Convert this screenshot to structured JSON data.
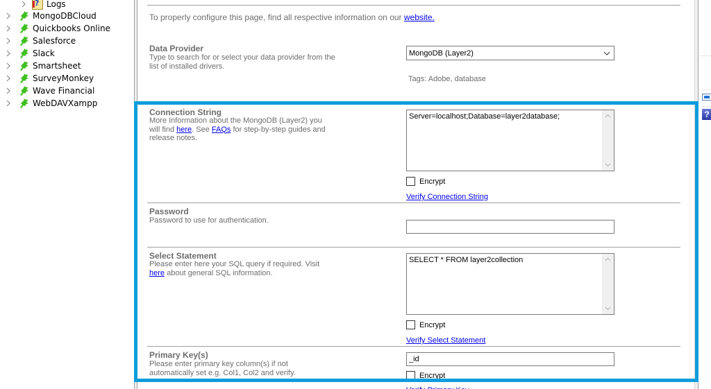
{
  "tree": {
    "items": [
      {
        "label": "Logs",
        "icon": "logs-icon"
      },
      {
        "label": "MongoDBCloud",
        "icon": "plugin-icon"
      },
      {
        "label": "Quickbooks Online",
        "icon": "plugin-icon"
      },
      {
        "label": "Salesforce",
        "icon": "plugin-icon"
      },
      {
        "label": "Slack",
        "icon": "plugin-icon"
      },
      {
        "label": "Smartsheet",
        "icon": "plugin-icon"
      },
      {
        "label": "SurveyMonkey",
        "icon": "plugin-icon"
      },
      {
        "label": "Wave Financial",
        "icon": "plugin-icon"
      },
      {
        "label": "WebDAVXampp",
        "icon": "plugin-icon"
      }
    ]
  },
  "main": {
    "info_text": "To properly configure this page, find all respective information on our ",
    "info_link": "website.",
    "data_provider": {
      "title": "Data Provider",
      "description": "Type to search for or select your data provider from the list of installed drivers.",
      "value": "MongoDB (Layer2)",
      "tags": "Tags: Adobe, database"
    },
    "connection_string": {
      "title": "Connection String",
      "desc_1": "More Information about the MongoDB (Layer2) you will find ",
      "link_here": "here",
      "desc_2": ". See ",
      "link_faqs": "FAQs",
      "desc_3": " for step-by-step guides and release notes.",
      "value": "Server=localhost;Database=layer2database;",
      "encrypt_label": "Encrypt",
      "encrypt_checked": false,
      "verify_label": "Verify Connection String"
    },
    "password": {
      "title": "Password",
      "description": "Password to use for authentication.",
      "value": ""
    },
    "select_statement": {
      "title": "Select Statement",
      "desc_1": "Please enter here your SQL query if required. Visit ",
      "link_here": "here",
      "desc_2": " about general SQL information.",
      "value": "SELECT * FROM layer2collection",
      "encrypt_label": "Encrypt",
      "encrypt_checked": false,
      "verify_label": "Verify Select Statement"
    },
    "primary_keys": {
      "title": "Primary Key(s)",
      "description": "Please enter primary key column(s) if not automatically set e.g. Col1, Col2 and verify.",
      "value": "_id",
      "encrypt_label": "Encrypt",
      "encrypt_checked": false,
      "verify_label": "Verify Primary Key"
    }
  },
  "colors": {
    "highlight": "#0e9ddc",
    "link": "#0000ee",
    "muted_text": "#6d6d6d"
  }
}
